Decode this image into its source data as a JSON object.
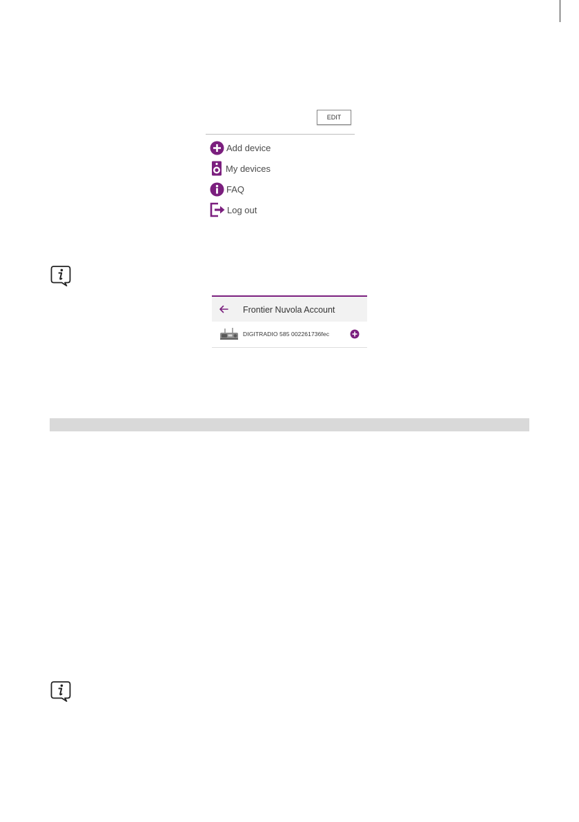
{
  "menu": {
    "edit_label": "EDIT",
    "items": [
      {
        "label": "Add device",
        "icon": "plus-circle-icon"
      },
      {
        "label": "My devices",
        "icon": "speaker-icon"
      },
      {
        "label": "FAQ",
        "icon": "info-circle-icon"
      },
      {
        "label": "Log out",
        "icon": "logout-icon"
      }
    ]
  },
  "account": {
    "title": "Frontier Nuvola Account",
    "device_name": "DIGITRADIO 585 002261736fec",
    "back_icon": "arrow-left-icon",
    "add_icon": "plus-circle-icon"
  },
  "notes": {
    "icon": "info-note-icon"
  },
  "colors": {
    "accent": "#7b1f7e",
    "section_bar": "#d9d9d9"
  }
}
